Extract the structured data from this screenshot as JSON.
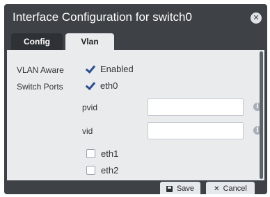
{
  "dialog": {
    "title": "Interface Configuration for switch0",
    "close_symbol": "✕"
  },
  "tabs": [
    {
      "label": "Config",
      "active": false
    },
    {
      "label": "Vlan",
      "active": true
    }
  ],
  "form": {
    "vlan_aware_label": "VLAN Aware",
    "vlan_aware_option": "Enabled",
    "vlan_aware_checked": true,
    "switch_ports_label": "Switch Ports",
    "ports": [
      {
        "name": "eth0",
        "checked": true
      },
      {
        "name": "eth1",
        "checked": false
      },
      {
        "name": "eth2",
        "checked": false
      }
    ],
    "pvid_label": "pvid",
    "pvid_value": "",
    "vid_label": "vid",
    "vid_value": "",
    "info_icon": "info-icon"
  },
  "footer": {
    "save_label": "Save",
    "cancel_label": "Cancel",
    "save_icon": "save-icon",
    "cancel_icon": "close-icon"
  },
  "colors": {
    "dialog_bg": "#3e4246",
    "content_bg": "#e9ebed",
    "checkmark": "#2a4f8f"
  }
}
